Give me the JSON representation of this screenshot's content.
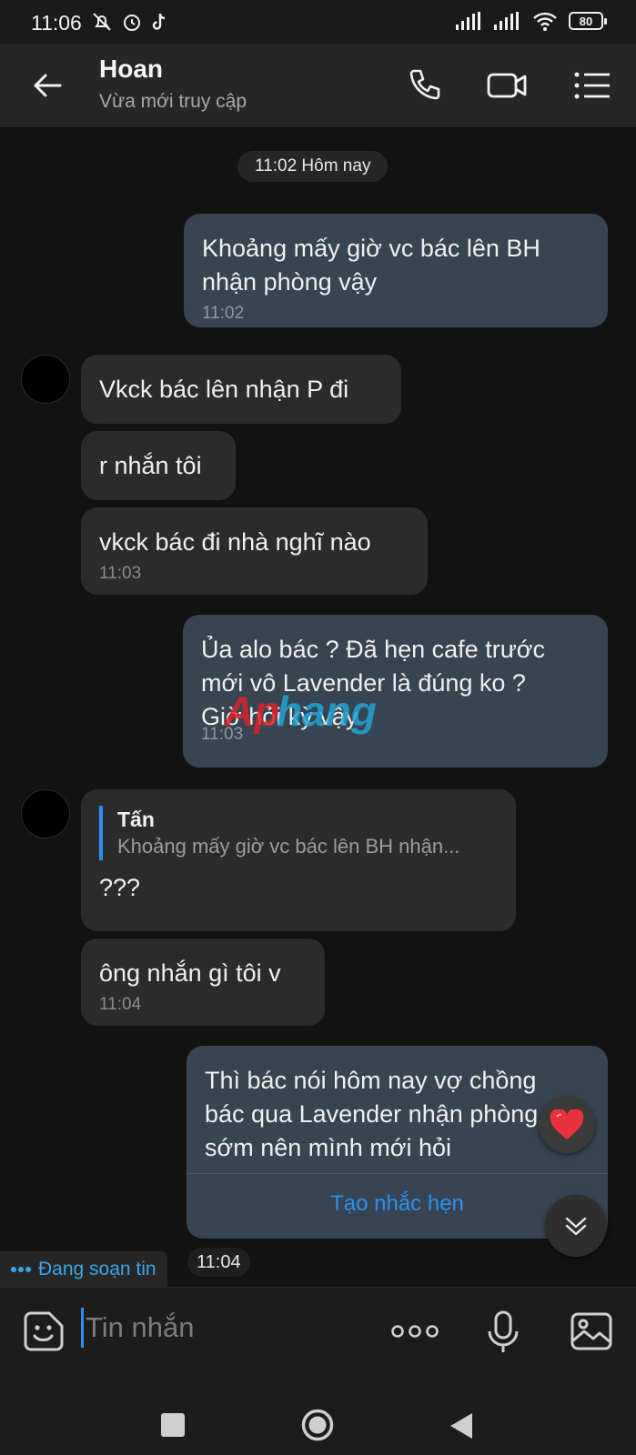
{
  "status_bar": {
    "time": "11:06",
    "battery": "80"
  },
  "header": {
    "name": "Hoan",
    "status": "Vừa mới truy cập"
  },
  "chat": {
    "date_chip": "11:02 Hôm nay",
    "messages": [
      {
        "dir": "out",
        "text": "Khoảng mấy giờ vc bác lên BH\nnhận phòng vậy",
        "time": "11:02"
      },
      {
        "dir": "in",
        "text": "Vkck bác lên nhận P đi"
      },
      {
        "dir": "in",
        "text": "r nhắn tôi"
      },
      {
        "dir": "in",
        "text": "vkck bác đi nhà nghĩ nào",
        "time": "11:03"
      },
      {
        "dir": "out",
        "text": "Ủa alo bác ? Đã hẹn cafe trước\nmới vô Lavender là đúng ko ?\nGiờ hỏi kỳ vậy",
        "time": "11:03"
      },
      {
        "dir": "in",
        "quote_name": "Tấn",
        "quote_text": "Khoảng mấy giờ vc bác lên BH nhận...",
        "text": "???"
      },
      {
        "dir": "in",
        "text": "ông nhắn gì tôi v",
        "time": "11:04"
      },
      {
        "dir": "out",
        "text": "Thì bác nói hôm nay vợ chồng\nbác qua Lavender nhận phòng\nsớm nên mình mới hỏi",
        "action": "Tạo nhắc hẹn"
      }
    ],
    "typing_indicator": "Đang soạn tin",
    "last_time": "11:04",
    "watermark": "Aphang"
  },
  "composer": {
    "placeholder": "Tin nhắn"
  },
  "icons": [
    "back-arrow-icon",
    "phone-icon",
    "video-call-icon",
    "list-menu-icon",
    "sticker-icon",
    "more-icon",
    "microphone-icon",
    "image-icon",
    "heart-reaction-icon",
    "chevron-down-icon"
  ],
  "colors": {
    "accent": "#2d90f0",
    "outgoing_bubble": "#374451",
    "incoming_bubble": "#2b2b2b",
    "background": "#121212"
  }
}
